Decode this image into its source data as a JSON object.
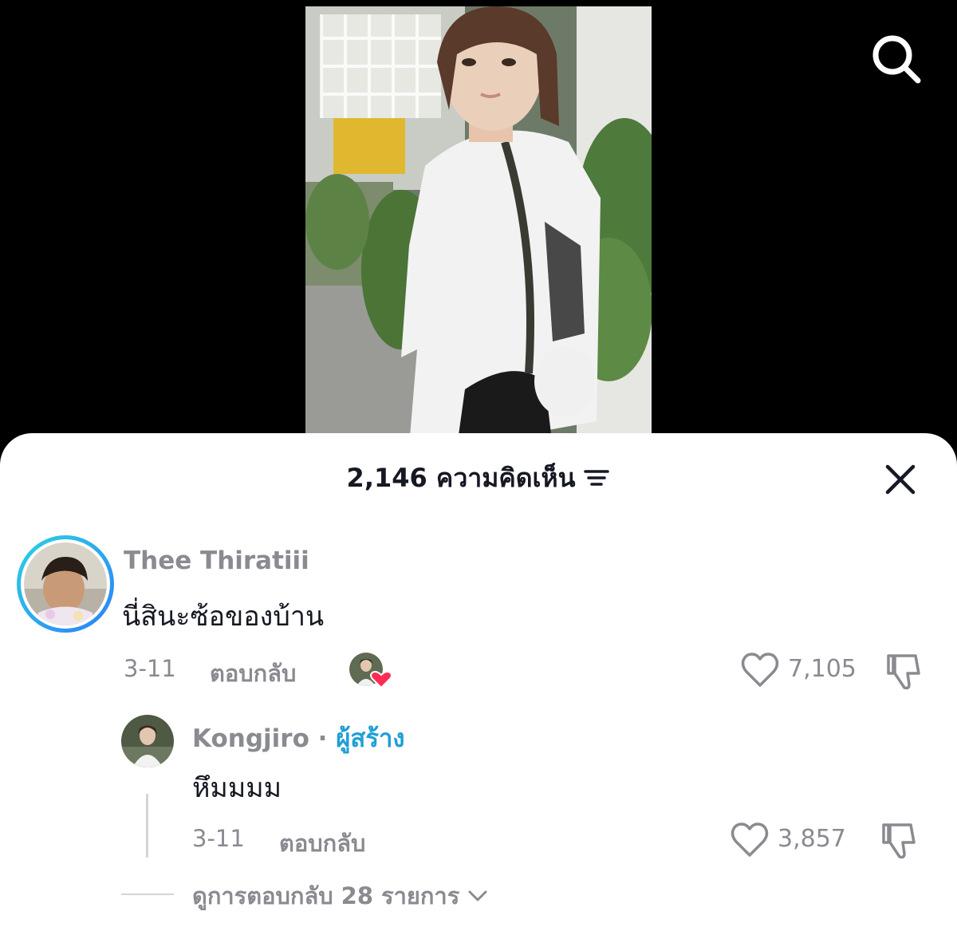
{
  "video": {
    "image_description": "person in white t-shirt with chain bag in front of tropical plants"
  },
  "header": {
    "comment_count": "2,146",
    "comments_label": "ความคิดเห็น"
  },
  "icons": {
    "search": "search-icon",
    "sort": "sort-icon",
    "close": "close-icon",
    "heart": "heart-icon",
    "dislike": "thumbs-down-icon",
    "expand": "chevron-down-icon"
  },
  "colors": {
    "avatar_ring_start": "#2ed3e0",
    "avatar_ring_end": "#2d7ff9",
    "creator_label": "#1f9fd6",
    "liked_badge": "#fe2c55",
    "muted_text": "#8a8b91"
  },
  "comments": [
    {
      "username": "Thee Thiratiii",
      "text": "นี่สินะซ้อของบ้าน",
      "date": "3-11",
      "reply_label": "ตอบกลับ",
      "likes": "7,105"
    }
  ],
  "reply": {
    "username": "Kongjiro",
    "separator": "·",
    "creator_label": "ผู้สร้าง",
    "text": "หึมมมม",
    "date": "3-11",
    "reply_label": "ตอบกลับ",
    "likes": "3,857"
  },
  "view_replies": {
    "prefix": "ดูการตอบกลับ",
    "count": "28",
    "suffix": "รายการ"
  }
}
